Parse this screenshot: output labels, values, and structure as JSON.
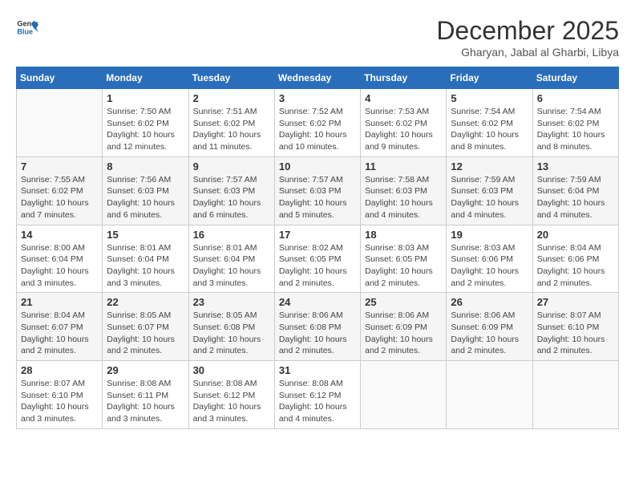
{
  "header": {
    "logo_line1": "General",
    "logo_line2": "Blue",
    "month": "December 2025",
    "location": "Gharyan, Jabal al Gharbi, Libya"
  },
  "weekdays": [
    "Sunday",
    "Monday",
    "Tuesday",
    "Wednesday",
    "Thursday",
    "Friday",
    "Saturday"
  ],
  "weeks": [
    [
      {
        "day": "",
        "empty": true
      },
      {
        "day": "1",
        "sunrise": "Sunrise: 7:50 AM",
        "sunset": "Sunset: 6:02 PM",
        "daylight": "Daylight: 10 hours and 12 minutes."
      },
      {
        "day": "2",
        "sunrise": "Sunrise: 7:51 AM",
        "sunset": "Sunset: 6:02 PM",
        "daylight": "Daylight: 10 hours and 11 minutes."
      },
      {
        "day": "3",
        "sunrise": "Sunrise: 7:52 AM",
        "sunset": "Sunset: 6:02 PM",
        "daylight": "Daylight: 10 hours and 10 minutes."
      },
      {
        "day": "4",
        "sunrise": "Sunrise: 7:53 AM",
        "sunset": "Sunset: 6:02 PM",
        "daylight": "Daylight: 10 hours and 9 minutes."
      },
      {
        "day": "5",
        "sunrise": "Sunrise: 7:54 AM",
        "sunset": "Sunset: 6:02 PM",
        "daylight": "Daylight: 10 hours and 8 minutes."
      },
      {
        "day": "6",
        "sunrise": "Sunrise: 7:54 AM",
        "sunset": "Sunset: 6:02 PM",
        "daylight": "Daylight: 10 hours and 8 minutes."
      }
    ],
    [
      {
        "day": "7",
        "sunrise": "Sunrise: 7:55 AM",
        "sunset": "Sunset: 6:02 PM",
        "daylight": "Daylight: 10 hours and 7 minutes."
      },
      {
        "day": "8",
        "sunrise": "Sunrise: 7:56 AM",
        "sunset": "Sunset: 6:03 PM",
        "daylight": "Daylight: 10 hours and 6 minutes."
      },
      {
        "day": "9",
        "sunrise": "Sunrise: 7:57 AM",
        "sunset": "Sunset: 6:03 PM",
        "daylight": "Daylight: 10 hours and 6 minutes."
      },
      {
        "day": "10",
        "sunrise": "Sunrise: 7:57 AM",
        "sunset": "Sunset: 6:03 PM",
        "daylight": "Daylight: 10 hours and 5 minutes."
      },
      {
        "day": "11",
        "sunrise": "Sunrise: 7:58 AM",
        "sunset": "Sunset: 6:03 PM",
        "daylight": "Daylight: 10 hours and 4 minutes."
      },
      {
        "day": "12",
        "sunrise": "Sunrise: 7:59 AM",
        "sunset": "Sunset: 6:03 PM",
        "daylight": "Daylight: 10 hours and 4 minutes."
      },
      {
        "day": "13",
        "sunrise": "Sunrise: 7:59 AM",
        "sunset": "Sunset: 6:04 PM",
        "daylight": "Daylight: 10 hours and 4 minutes."
      }
    ],
    [
      {
        "day": "14",
        "sunrise": "Sunrise: 8:00 AM",
        "sunset": "Sunset: 6:04 PM",
        "daylight": "Daylight: 10 hours and 3 minutes."
      },
      {
        "day": "15",
        "sunrise": "Sunrise: 8:01 AM",
        "sunset": "Sunset: 6:04 PM",
        "daylight": "Daylight: 10 hours and 3 minutes."
      },
      {
        "day": "16",
        "sunrise": "Sunrise: 8:01 AM",
        "sunset": "Sunset: 6:04 PM",
        "daylight": "Daylight: 10 hours and 3 minutes."
      },
      {
        "day": "17",
        "sunrise": "Sunrise: 8:02 AM",
        "sunset": "Sunset: 6:05 PM",
        "daylight": "Daylight: 10 hours and 2 minutes."
      },
      {
        "day": "18",
        "sunrise": "Sunrise: 8:03 AM",
        "sunset": "Sunset: 6:05 PM",
        "daylight": "Daylight: 10 hours and 2 minutes."
      },
      {
        "day": "19",
        "sunrise": "Sunrise: 8:03 AM",
        "sunset": "Sunset: 6:06 PM",
        "daylight": "Daylight: 10 hours and 2 minutes."
      },
      {
        "day": "20",
        "sunrise": "Sunrise: 8:04 AM",
        "sunset": "Sunset: 6:06 PM",
        "daylight": "Daylight: 10 hours and 2 minutes."
      }
    ],
    [
      {
        "day": "21",
        "sunrise": "Sunrise: 8:04 AM",
        "sunset": "Sunset: 6:07 PM",
        "daylight": "Daylight: 10 hours and 2 minutes."
      },
      {
        "day": "22",
        "sunrise": "Sunrise: 8:05 AM",
        "sunset": "Sunset: 6:07 PM",
        "daylight": "Daylight: 10 hours and 2 minutes."
      },
      {
        "day": "23",
        "sunrise": "Sunrise: 8:05 AM",
        "sunset": "Sunset: 6:08 PM",
        "daylight": "Daylight: 10 hours and 2 minutes."
      },
      {
        "day": "24",
        "sunrise": "Sunrise: 8:06 AM",
        "sunset": "Sunset: 6:08 PM",
        "daylight": "Daylight: 10 hours and 2 minutes."
      },
      {
        "day": "25",
        "sunrise": "Sunrise: 8:06 AM",
        "sunset": "Sunset: 6:09 PM",
        "daylight": "Daylight: 10 hours and 2 minutes."
      },
      {
        "day": "26",
        "sunrise": "Sunrise: 8:06 AM",
        "sunset": "Sunset: 6:09 PM",
        "daylight": "Daylight: 10 hours and 2 minutes."
      },
      {
        "day": "27",
        "sunrise": "Sunrise: 8:07 AM",
        "sunset": "Sunset: 6:10 PM",
        "daylight": "Daylight: 10 hours and 2 minutes."
      }
    ],
    [
      {
        "day": "28",
        "sunrise": "Sunrise: 8:07 AM",
        "sunset": "Sunset: 6:10 PM",
        "daylight": "Daylight: 10 hours and 3 minutes."
      },
      {
        "day": "29",
        "sunrise": "Sunrise: 8:08 AM",
        "sunset": "Sunset: 6:11 PM",
        "daylight": "Daylight: 10 hours and 3 minutes."
      },
      {
        "day": "30",
        "sunrise": "Sunrise: 8:08 AM",
        "sunset": "Sunset: 6:12 PM",
        "daylight": "Daylight: 10 hours and 3 minutes."
      },
      {
        "day": "31",
        "sunrise": "Sunrise: 8:08 AM",
        "sunset": "Sunset: 6:12 PM",
        "daylight": "Daylight: 10 hours and 4 minutes."
      },
      {
        "day": "",
        "empty": true
      },
      {
        "day": "",
        "empty": true
      },
      {
        "day": "",
        "empty": true
      }
    ]
  ]
}
